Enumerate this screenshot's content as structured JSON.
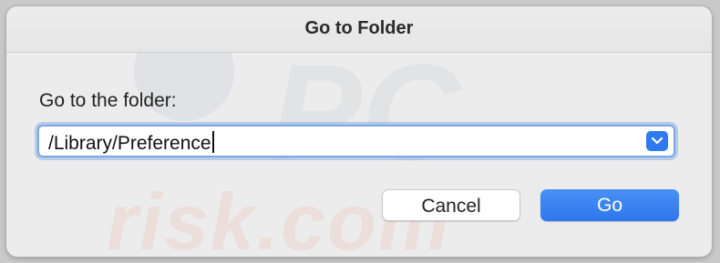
{
  "dialog": {
    "title": "Go to Folder",
    "prompt_label": "Go to the folder:",
    "path_value": "/Library/Preference",
    "dropdown_icon": "chevron-down-icon",
    "accent_color": "#2f7af0"
  },
  "buttons": {
    "cancel_label": "Cancel",
    "go_label": "Go"
  },
  "watermark": {
    "text": "risk.com",
    "logo_text": "PC"
  }
}
